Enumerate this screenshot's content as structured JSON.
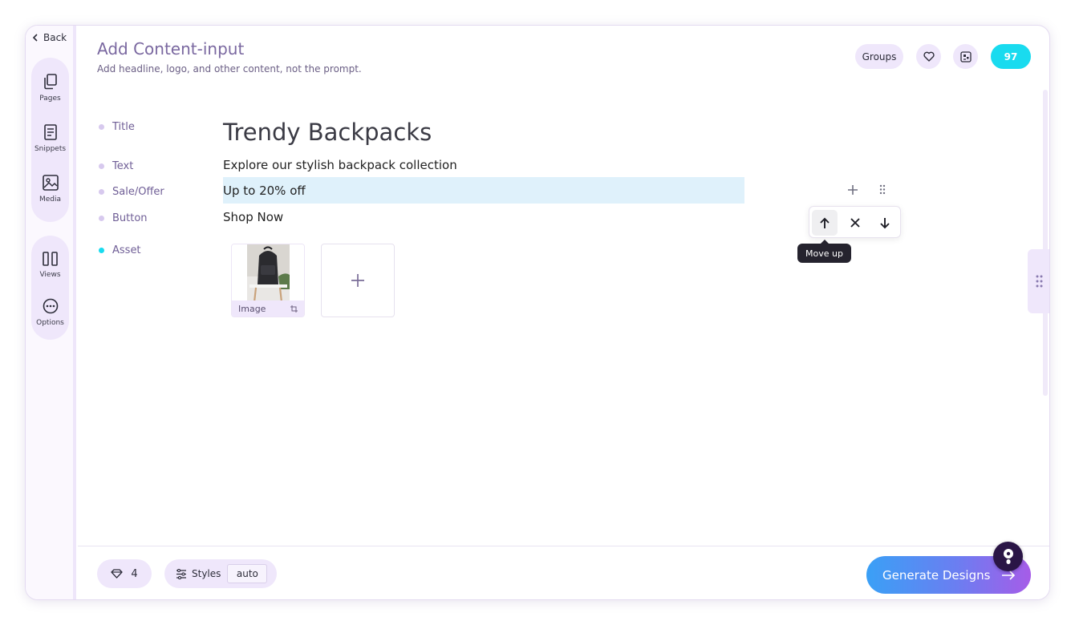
{
  "nav": {
    "back_label": "Back",
    "top_items": [
      {
        "label": "Pages",
        "icon": "pages-icon"
      },
      {
        "label": "Snippets",
        "icon": "snippets-icon"
      },
      {
        "label": "Media",
        "icon": "media-icon"
      }
    ],
    "bottom_items": [
      {
        "label": "Views",
        "icon": "views-icon"
      },
      {
        "label": "Options",
        "icon": "options-icon"
      }
    ]
  },
  "header": {
    "title": "Add Content-input",
    "subtitle": "Add headline, logo, and other content, not the prompt.",
    "groups_label": "Groups",
    "credits": "97"
  },
  "fields": [
    {
      "label": "Title",
      "active": false
    },
    {
      "label": "Text",
      "active": false
    },
    {
      "label": "Sale/Offer",
      "active": false
    },
    {
      "label": "Button",
      "active": false
    },
    {
      "label": "Asset",
      "active": true
    }
  ],
  "content": {
    "headline": "Trendy Backpacks",
    "text": "Explore our stylish backpack collection",
    "offer": "Up to 20% off",
    "button": "Shop Now",
    "asset_label": "Image",
    "add_symbol": "+"
  },
  "row_tools": {
    "tooltip": "Move up"
  },
  "bottom": {
    "gems_count": "4",
    "styles_label": "Styles",
    "styles_value": "auto",
    "generate_label": "Generate Designs"
  },
  "colors": {
    "accent": "#19dbef",
    "lavender": "#efe7fb",
    "selection": "#dff1fb",
    "gradient_start": "#3aa0f6",
    "gradient_end": "#a65ce8"
  }
}
